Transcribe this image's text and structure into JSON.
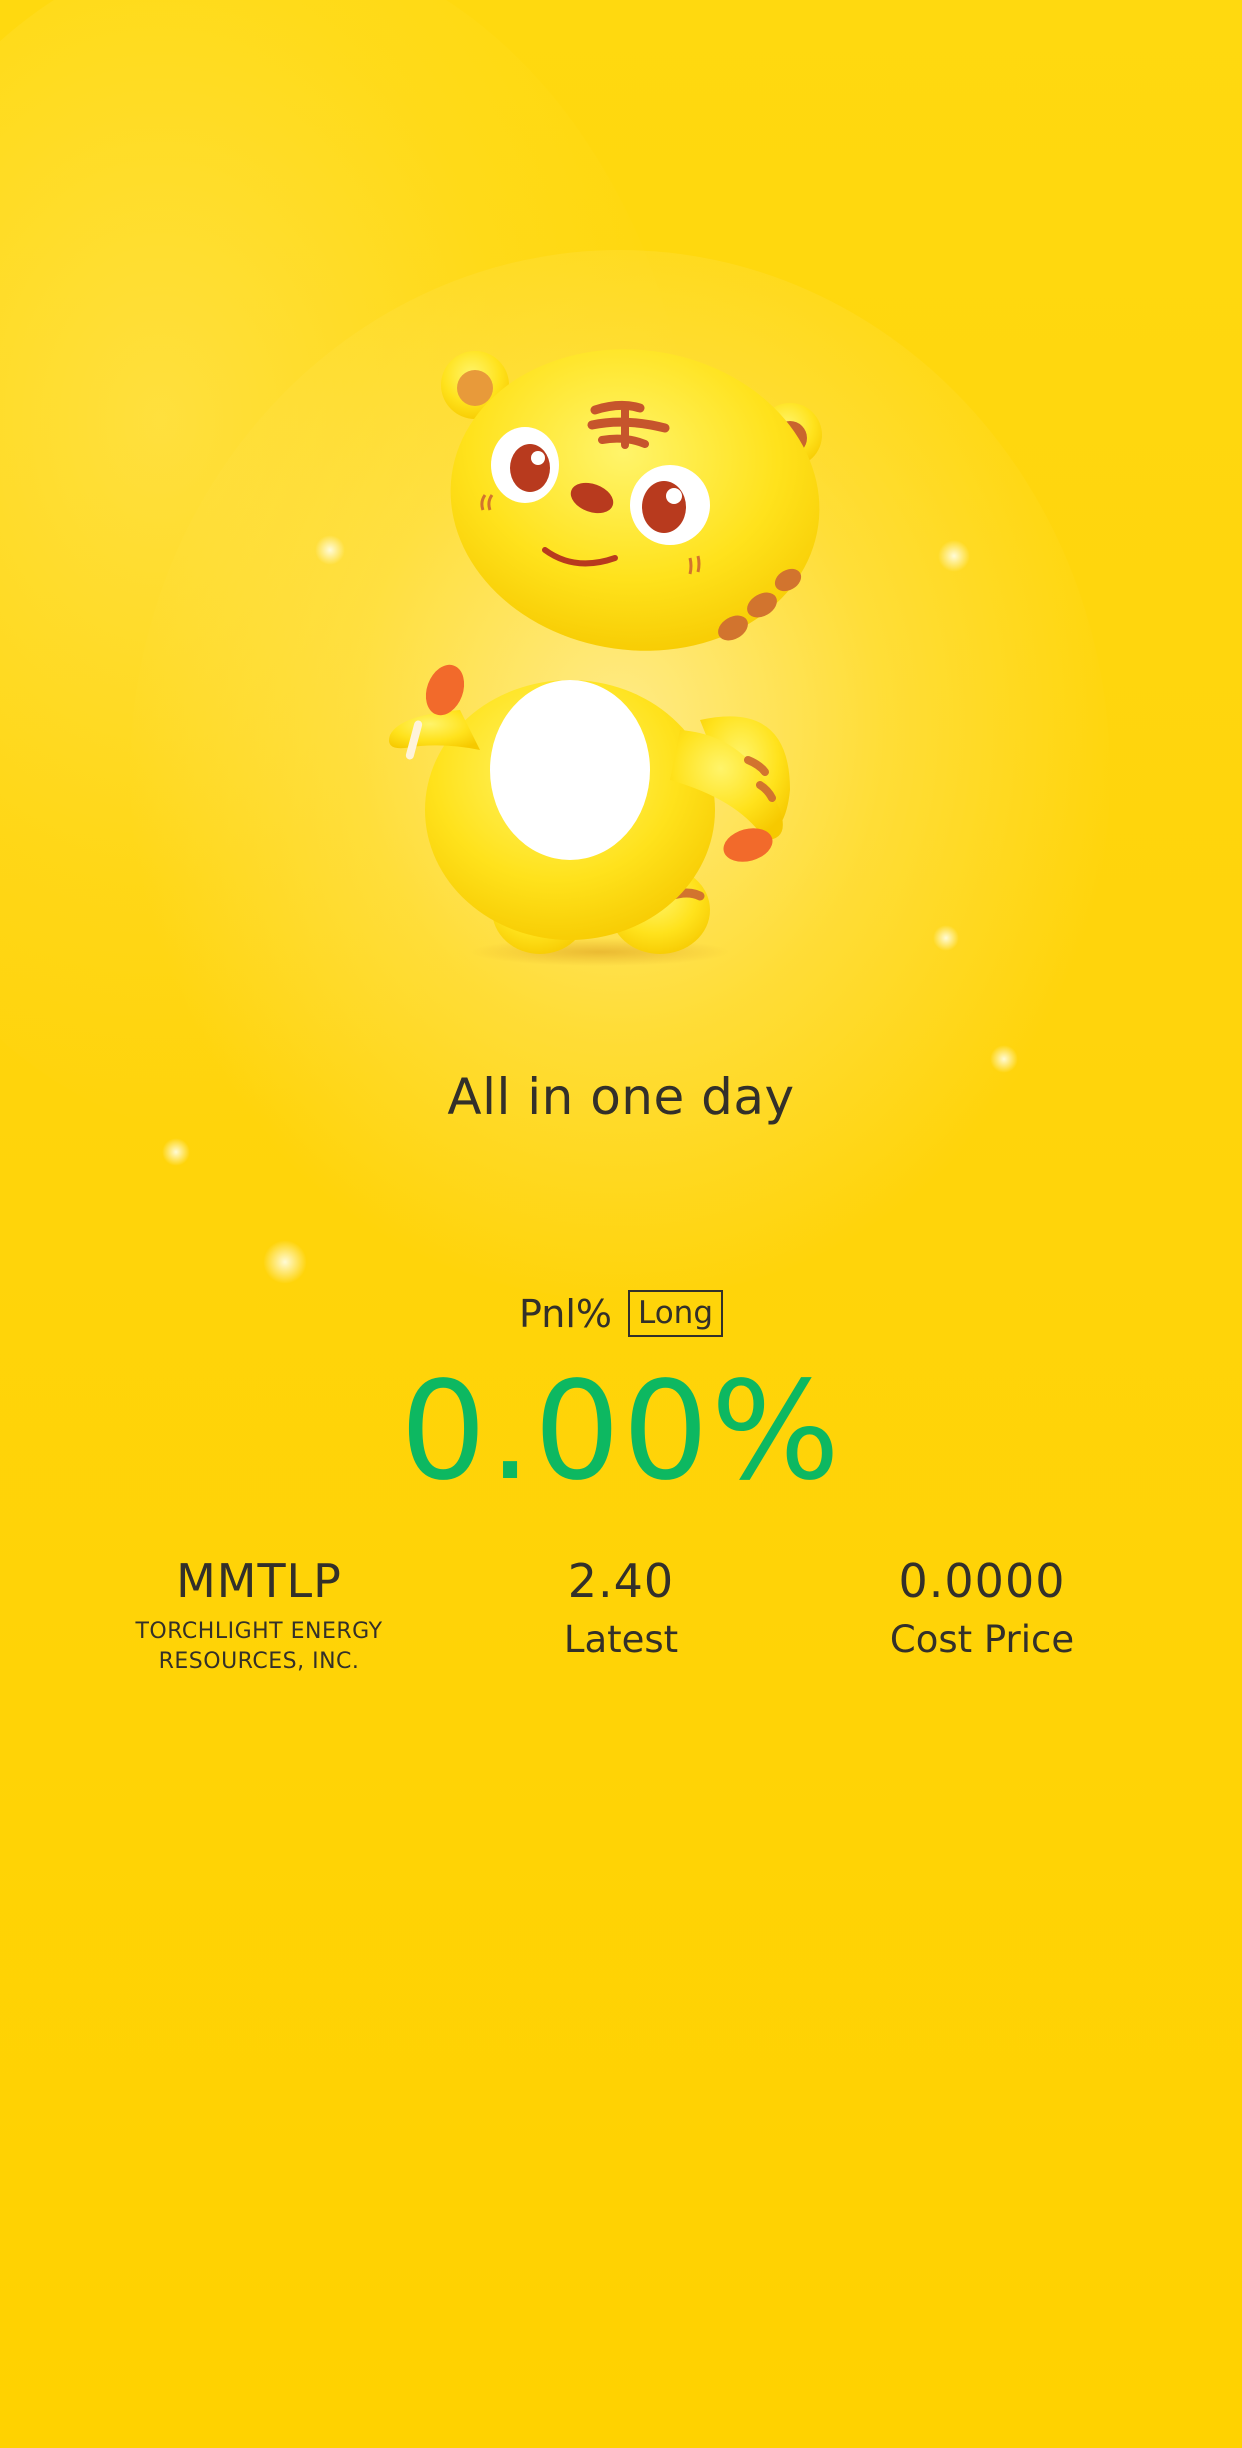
{
  "tagline": "All in one day",
  "pnl": {
    "label": "Pnl%",
    "position_badge": "Long",
    "value": "0.00%",
    "value_color": "#0DB861"
  },
  "stock": {
    "symbol": "MMTLP",
    "company_name": "TORCHLIGHT ENERGY RESOURCES, INC."
  },
  "latest": {
    "value": "2.40",
    "label": "Latest"
  },
  "cost": {
    "value": "0.0000",
    "label": "Cost Price"
  },
  "colors": {
    "background": "#FFD60A",
    "text": "#33302A",
    "positive": "#0DB861"
  },
  "icons": {
    "mascot": "tiger-mascot-icon"
  }
}
